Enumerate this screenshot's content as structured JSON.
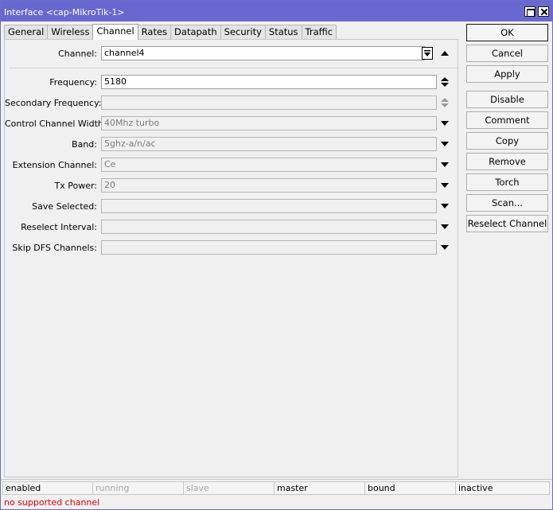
{
  "window": {
    "title": "Interface <cap-MikroTik-1>"
  },
  "tabs": [
    "General",
    "Wireless",
    "Channel",
    "Rates",
    "Datapath",
    "Security",
    "Status",
    "Traffic"
  ],
  "active_tab": "Channel",
  "fields": {
    "channel": {
      "label": "Channel:",
      "value": "channel4"
    },
    "frequency": {
      "label": "Frequency:",
      "value": "5180"
    },
    "secondary_frequency": {
      "label": "Secondary Frequency:",
      "value": ""
    },
    "control_channel_width": {
      "label": "Control Channel Width:",
      "value": "40Mhz turbo"
    },
    "band": {
      "label": "Band:",
      "value": "5ghz-a/n/ac"
    },
    "extension_channel": {
      "label": "Extension Channel:",
      "value": "Ce"
    },
    "tx_power": {
      "label": "Tx Power:",
      "value": "20"
    },
    "save_selected": {
      "label": "Save Selected:",
      "value": ""
    },
    "reselect_interval": {
      "label": "Reselect Interval:",
      "value": ""
    },
    "skip_dfs_channels": {
      "label": "Skip DFS Channels:",
      "value": ""
    }
  },
  "buttons": {
    "ok": "OK",
    "cancel": "Cancel",
    "apply": "Apply",
    "disable": "Disable",
    "comment": "Comment",
    "copy": "Copy",
    "remove": "Remove",
    "torch": "Torch",
    "scan": "Scan...",
    "reselect_channel": "Reselect Channel"
  },
  "status": {
    "enabled": "enabled",
    "running": "running",
    "slave": "slave",
    "master": "master",
    "bound": "bound",
    "inactive": "inactive"
  },
  "error": "no supported channel",
  "colors": {
    "titlebar": "#6868d0",
    "error_text": "#e00000",
    "dim_text": "#a8a8a8"
  }
}
